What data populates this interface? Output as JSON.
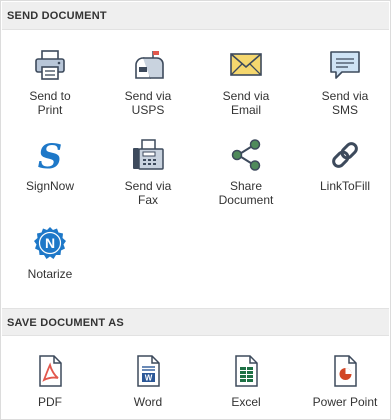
{
  "send_section": {
    "title": "SEND DOCUMENT",
    "items": [
      {
        "label": "Send to\nPrint",
        "icon": "printer-icon"
      },
      {
        "label": "Send via\nUSPS",
        "icon": "mailbox-icon"
      },
      {
        "label": "Send via\nEmail",
        "icon": "envelope-icon"
      },
      {
        "label": "Send via\nSMS",
        "icon": "chat-bubble-icon"
      },
      {
        "label": "SignNow",
        "icon": "signnow-icon"
      },
      {
        "label": "Send via\nFax",
        "icon": "fax-icon"
      },
      {
        "label": "Share\nDocument",
        "icon": "share-icon"
      },
      {
        "label": "LinkToFill",
        "icon": "link-icon"
      },
      {
        "label": "Notarize",
        "icon": "notarize-seal-icon"
      }
    ]
  },
  "save_section": {
    "title": "SAVE DOCUMENT AS",
    "items": [
      {
        "label": "PDF",
        "icon": "pdf-file-icon"
      },
      {
        "label": "Word",
        "icon": "word-file-icon"
      },
      {
        "label": "Excel",
        "icon": "excel-file-icon"
      },
      {
        "label": "Power Point",
        "icon": "powerpoint-file-icon"
      }
    ]
  },
  "colors": {
    "header_bg": "#efefef",
    "icon_dark": "#3d4a5c",
    "signnow_blue": "#1e78c8",
    "pdf_red": "#e2574c",
    "word_blue": "#2b5797",
    "excel_green": "#1e7145",
    "ppt_orange": "#d24726",
    "envelope_yellow": "#f5d76e"
  }
}
